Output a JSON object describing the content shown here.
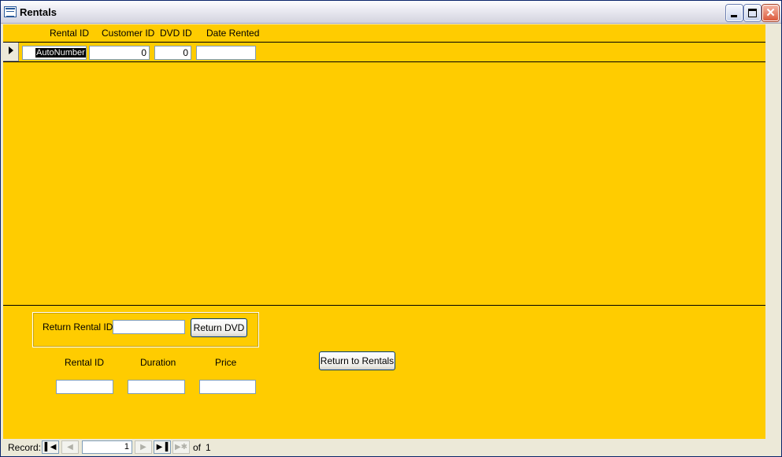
{
  "window": {
    "title": "Rentals"
  },
  "header": {
    "rental_id_label": "Rental ID",
    "customer_id_label": "Customer ID",
    "dvd_id_label": "DVD ID",
    "date_rented_label": "Date Rented"
  },
  "record": {
    "rental_id": "AutoNumber",
    "customer_id": "0",
    "dvd_id": "0",
    "date_rented": ""
  },
  "footer": {
    "return_rental_id_label": "Return Rental ID",
    "return_rental_id_value": "",
    "return_dvd_button": "Return DVD",
    "rental_id_label": "Rental ID",
    "duration_label": "Duration",
    "price_label": "Price",
    "rental_id_value": "",
    "duration_value": "",
    "price_value": "",
    "return_to_rentals_button": "Return to Rentals"
  },
  "navigation": {
    "record_label": "Record:",
    "current_record": "1",
    "of_label": "of",
    "total_records": "1",
    "first_icon": "first-record-icon",
    "prev_icon": "previous-record-icon",
    "next_icon": "next-record-icon",
    "last_icon": "last-record-icon",
    "new_icon": "new-record-icon"
  },
  "colors": {
    "form_background": "#ffcc00",
    "chrome": "#ece9d8"
  }
}
